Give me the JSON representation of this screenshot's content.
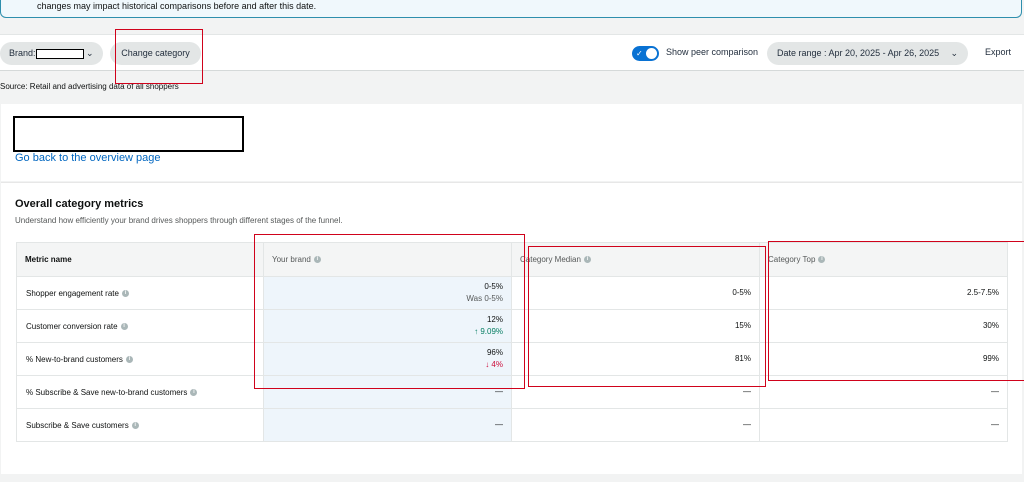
{
  "banner": {
    "text": "changes may impact historical comparisons before and after this date."
  },
  "toolbar": {
    "brand_label": "Brand:",
    "change_category": "Change category",
    "peer_label": "Show peer comparison",
    "date_range": "Date range : Apr 20, 2025 - Apr 26, 2025",
    "export": "Export",
    "peer_toggle_on": true
  },
  "source": "Source: Retail and advertising data of all shoppers",
  "header": {
    "back_link": "Go back to the overview page"
  },
  "metrics": {
    "title": "Overall category metrics",
    "subtitle": "Understand how efficiently your brand drives shoppers through different stages of the funnel.",
    "columns": [
      "Metric name",
      "Your brand",
      "Category Median",
      "Category Top"
    ],
    "rows": [
      {
        "name": "Shopper engagement rate",
        "brand": "0-5%",
        "brand_sub": "Was 0-5%",
        "median": "0-5%",
        "top": "2.5-7.5%"
      },
      {
        "name": "Customer conversion rate",
        "brand": "12%",
        "brand_sub": "↑ 9.09%",
        "median": "15%",
        "top": "30%"
      },
      {
        "name": "% New-to-brand customers",
        "brand": "96%",
        "brand_sub": "↓ 4%",
        "median": "81%",
        "top": "99%"
      },
      {
        "name": "% Subscribe & Save new-to-brand customers",
        "brand": "—",
        "brand_sub": "",
        "median": "—",
        "top": "—"
      },
      {
        "name": "Subscribe & Save customers",
        "brand": "—",
        "brand_sub": "",
        "median": "—",
        "top": "—"
      }
    ]
  },
  "colors": {
    "accent": "#0972d3",
    "link": "#0066c0",
    "positive": "#067d62",
    "negative": "#cc0c39",
    "annotation": "#d0021b"
  }
}
